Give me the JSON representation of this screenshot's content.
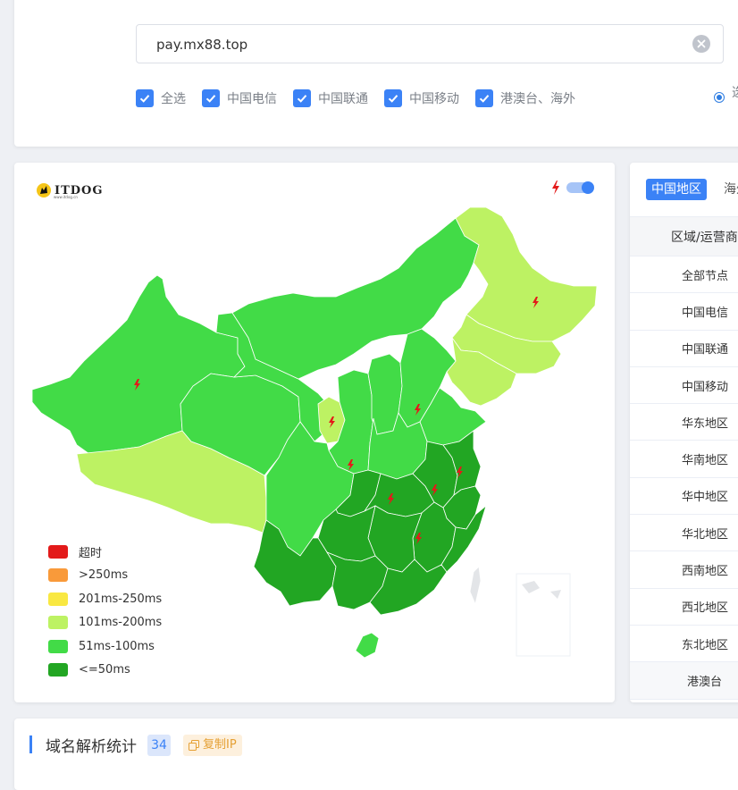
{
  "search": {
    "value": "pay.mx88.top"
  },
  "filters": {
    "items": [
      {
        "label": "全选",
        "checked": true
      },
      {
        "label": "中国电信",
        "checked": true
      },
      {
        "label": "中国联通",
        "checked": true
      },
      {
        "label": "中国移动",
        "checked": true
      },
      {
        "label": "港澳台、海外",
        "checked": true
      }
    ],
    "radio_label": "选"
  },
  "map": {
    "logo_text": "ITDOG",
    "logo_sub": "www.itdog.cn",
    "toggle_on": true,
    "legend": [
      {
        "label": "超时",
        "color": "#e31a1a"
      },
      {
        "label": ">250ms",
        "color": "#f99a3a"
      },
      {
        "label": "201ms-250ms",
        "color": "#f9e842"
      },
      {
        "label": "101ms-200ms",
        "color": "#bdf263"
      },
      {
        "label": "51ms-100ms",
        "color": "#42db47"
      },
      {
        "label": "<=50ms",
        "color": "#22a623"
      }
    ]
  },
  "side": {
    "tab_active": "中国地区",
    "tab_other": "海外",
    "header": "区域/运营商",
    "rows": [
      "全部节点",
      "中国电信",
      "中国联通",
      "中国移动",
      "华东地区",
      "华南地区",
      "华中地区",
      "华北地区",
      "西南地区",
      "西北地区",
      "东北地区",
      "港澳台"
    ]
  },
  "dns": {
    "title": "域名解析统计",
    "count": "34",
    "copy_label": "复制IP"
  }
}
